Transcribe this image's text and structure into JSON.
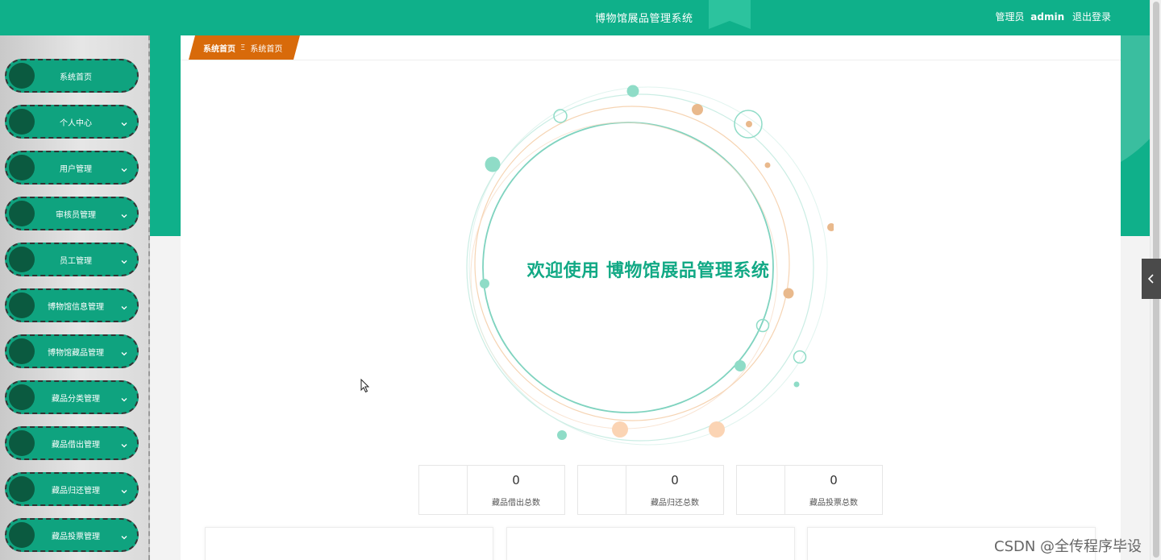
{
  "header": {
    "title": "博物馆展品管理系统",
    "user_role": "管理员",
    "user_name": "admin",
    "logout": "退出登录"
  },
  "colors": {
    "brand": "#0fb08a",
    "crumb": "#d86a0a",
    "menu_item": "#0fa37f",
    "menu_dot": "#0b5a40"
  },
  "sidebar": {
    "items": [
      {
        "label": "系统首页",
        "has_chevron": false
      },
      {
        "label": "个人中心",
        "has_chevron": true
      },
      {
        "label": "用户管理",
        "has_chevron": true
      },
      {
        "label": "审核员管理",
        "has_chevron": true
      },
      {
        "label": "员工管理",
        "has_chevron": true
      },
      {
        "label": "博物馆信息管理",
        "has_chevron": true
      },
      {
        "label": "博物馆藏品管理",
        "has_chevron": true
      },
      {
        "label": "藏品分类管理",
        "has_chevron": true
      },
      {
        "label": "藏品借出管理",
        "has_chevron": true
      },
      {
        "label": "藏品归还管理",
        "has_chevron": true
      },
      {
        "label": "藏品投票管理",
        "has_chevron": true
      }
    ]
  },
  "breadcrumb": {
    "home": "系统首页",
    "separator": "Ξ",
    "current": "系统首页"
  },
  "welcome": "欢迎使用 博物馆展品管理系统",
  "stats": [
    {
      "value": "0",
      "label": "藏品借出总数"
    },
    {
      "value": "0",
      "label": "藏品归还总数"
    },
    {
      "value": "0",
      "label": "藏品投票总数"
    }
  ],
  "watermark": "CSDN @全传程序毕设",
  "icons": {
    "chevron": "chevron-down-icon",
    "collapse": "chevron-left-icon"
  }
}
